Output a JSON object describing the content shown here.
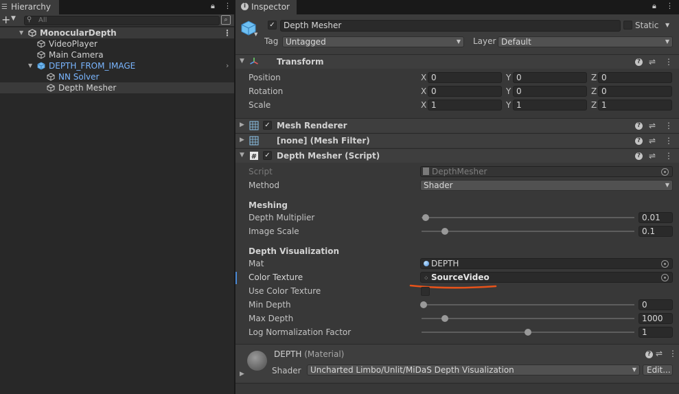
{
  "hierarchy": {
    "tab_label": "Hierarchy",
    "search_placeholder": "All",
    "scene": "MonocularDepth",
    "items": [
      {
        "label": "VideoPlayer"
      },
      {
        "label": "Main Camera"
      },
      {
        "label": "DEPTH_FROM_IMAGE"
      },
      {
        "label": "NN Solver"
      },
      {
        "label": "Depth Mesher"
      }
    ]
  },
  "inspector": {
    "tab_label": "Inspector",
    "object_name": "Depth Mesher",
    "static_label": "Static",
    "tag_label": "Tag",
    "tag_value": "Untagged",
    "layer_label": "Layer",
    "layer_value": "Default",
    "transform": {
      "title": "Transform",
      "rows": [
        {
          "label": "Position",
          "x": "0",
          "y": "0",
          "z": "0"
        },
        {
          "label": "Rotation",
          "x": "0",
          "y": "0",
          "z": "0"
        },
        {
          "label": "Scale",
          "x": "1",
          "y": "1",
          "z": "1"
        }
      ],
      "axis_x": "X",
      "axis_y": "Y",
      "axis_z": "Z"
    },
    "mesh_renderer": {
      "title": "Mesh Renderer"
    },
    "mesh_filter": {
      "title": "[none] (Mesh Filter)"
    },
    "script": {
      "title": "Depth Mesher (Script)",
      "script_label": "Script",
      "script_value": "DepthMesher",
      "method_label": "Method",
      "method_value": "Shader",
      "meshing_header": "Meshing",
      "depth_multiplier_label": "Depth Multiplier",
      "depth_multiplier_value": "0.01",
      "image_scale_label": "Image Scale",
      "image_scale_value": "0.1",
      "depth_vis_header": "Depth Visualization",
      "mat_label": "Mat",
      "mat_value": "DEPTH",
      "color_texture_label": "Color Texture",
      "color_texture_value": "SourceVideo",
      "use_color_texture_label": "Use Color Texture",
      "min_depth_label": "Min Depth",
      "min_depth_value": "0",
      "max_depth_label": "Max Depth",
      "max_depth_value": "1000",
      "log_norm_label": "Log Normalization Factor",
      "log_norm_value": "1"
    },
    "material": {
      "name": "DEPTH",
      "type": "(Material)",
      "shader_label": "Shader",
      "shader_value": "Uncharted Limbo/Unlit/MiDaS Depth Visualization",
      "edit_label": "Edit..."
    }
  },
  "colors": {
    "selection_blue": "#7ab6ff",
    "annotation_orange": "#e8531a"
  }
}
